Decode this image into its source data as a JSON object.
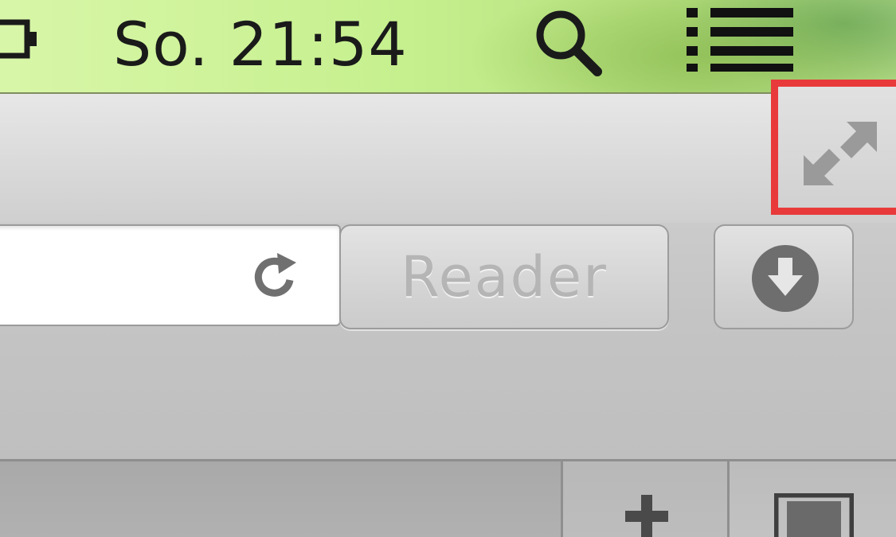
{
  "menubar": {
    "clock": "So. 21:54",
    "battery_icon": "battery-icon",
    "spotlight_icon": "spotlight-search-icon",
    "notification_icon": "notification-center-icon"
  },
  "toolbar": {
    "fullscreen_icon": "fullscreen-arrows-icon",
    "reload_icon": "reload-icon",
    "reader_label": "Reader",
    "downloads_icon": "download-arrow-icon",
    "highlight_color": "#e83a3a"
  },
  "tabbar": {
    "new_tab_icon": "plus-icon",
    "tab_overview_icon": "tab-overview-icon"
  }
}
